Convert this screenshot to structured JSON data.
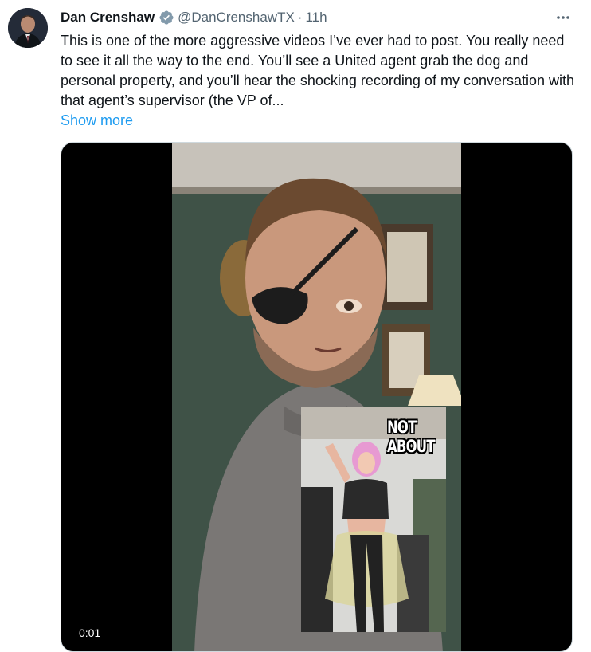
{
  "tweet": {
    "author": {
      "display_name": "Dan Crenshaw",
      "handle": "@DanCrenshawTX",
      "verified": true
    },
    "separator": "·",
    "timestamp": "11h",
    "text": "This is one of the more aggressive videos I’ve ever had to post. You really need to see it all the way to the end. You’ll see a United agent grab the dog and personal property, and you’ll hear the shocking recording of my conversation with that agent’s supervisor (the VP of...",
    "show_more": "Show more"
  },
  "media": {
    "type": "video",
    "overlay_caption": "NOT ABOUT",
    "time_label": "0:01"
  },
  "icons": {
    "verified": "verified-badge-icon",
    "more": "more-options-icon"
  },
  "colors": {
    "text": "#0f1419",
    "secondary_text": "#536471",
    "link": "#1d9bf0",
    "verified_badge": "#829aab"
  }
}
